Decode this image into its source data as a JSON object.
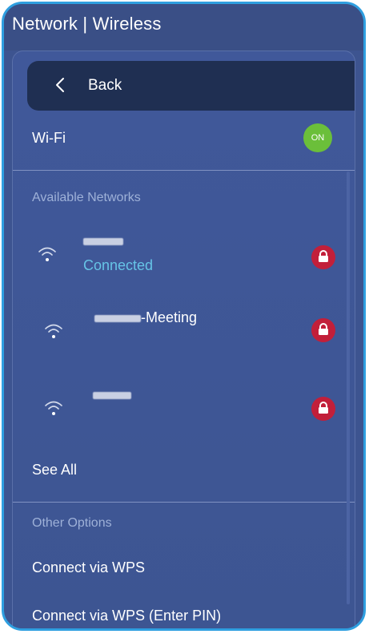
{
  "header": {
    "title": "Network | Wireless"
  },
  "back": {
    "label": "Back"
  },
  "wifi": {
    "label": "Wi-Fi",
    "toggle_label": "ON"
  },
  "available": {
    "heading": "Available Networks",
    "networks": [
      {
        "name_suffix": "",
        "status": "Connected",
        "locked": true
      },
      {
        "name_suffix": "-Meeting",
        "status": "",
        "locked": true
      },
      {
        "name_suffix": "",
        "status": "",
        "locked": true
      }
    ],
    "see_all": "See All"
  },
  "other": {
    "heading": "Other Options",
    "items": [
      "Connect via WPS",
      "Connect via WPS (Enter PIN)"
    ]
  },
  "colors": {
    "accent_toggle": "#6bbf3a",
    "lock_badge": "#c21f3a",
    "connected_text": "#66c4e6",
    "frame_border": "#2f9fe0"
  },
  "icons": [
    "chevron-left-icon",
    "wifi-icon",
    "lock-icon"
  ]
}
